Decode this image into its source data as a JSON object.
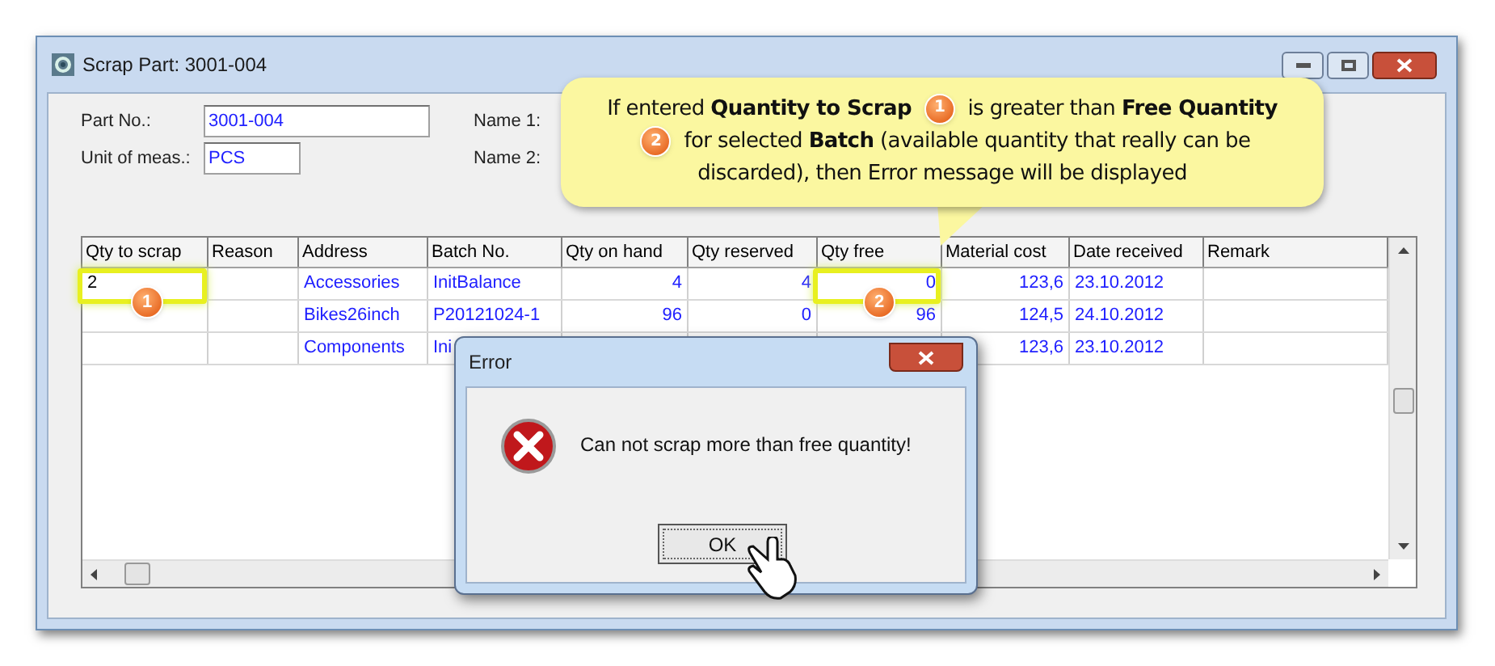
{
  "window": {
    "title": "Scrap Part: 3001-004"
  },
  "fields": [
    {
      "label": "Part No.:",
      "value": "3001-004"
    },
    {
      "label": "Unit of meas.:",
      "value": "PCS"
    },
    {
      "label": "Name 1:"
    },
    {
      "label": "Name 2:"
    }
  ],
  "table": {
    "columns": [
      "Qty to scrap",
      "Reason",
      "Address",
      "Batch No.",
      "Qty on hand",
      "Qty reserved",
      "Qty free",
      "Material cost",
      "Date received",
      "Remark"
    ],
    "rows": [
      {
        "cells": [
          {
            "text": "2",
            "badge": "1"
          },
          "",
          "Accessories",
          "InitBalance",
          "4",
          "4",
          {
            "text": "0",
            "badge": "2"
          },
          "123,6",
          "23.10.2012",
          ""
        ]
      },
      {
        "cells": [
          "",
          "",
          "Bikes26inch",
          "P20121024-1",
          "96",
          "0",
          "96",
          "124,5",
          "24.10.2012",
          ""
        ]
      },
      {
        "cells": [
          "",
          "",
          "Components",
          "Ini",
          "",
          "",
          "",
          "123,6",
          "23.10.2012",
          ""
        ]
      }
    ]
  },
  "callout": {
    "segments": [
      {
        "kind": "text",
        "text": "If entered **Quantity to Scrap**"
      },
      {
        "kind": "badge",
        "text": "1"
      },
      {
        "kind": "text",
        "text": "is greater than **Free Quantity**"
      },
      {
        "kind": "badge",
        "text": "2"
      },
      {
        "kind": "text",
        "text": "for selected **Batch** (available quantity that really can be discarded), then Error message will be displayed"
      }
    ]
  },
  "dialog": {
    "title": "Error",
    "message": "Can not scrap more than free quantity!",
    "button": "OK"
  }
}
